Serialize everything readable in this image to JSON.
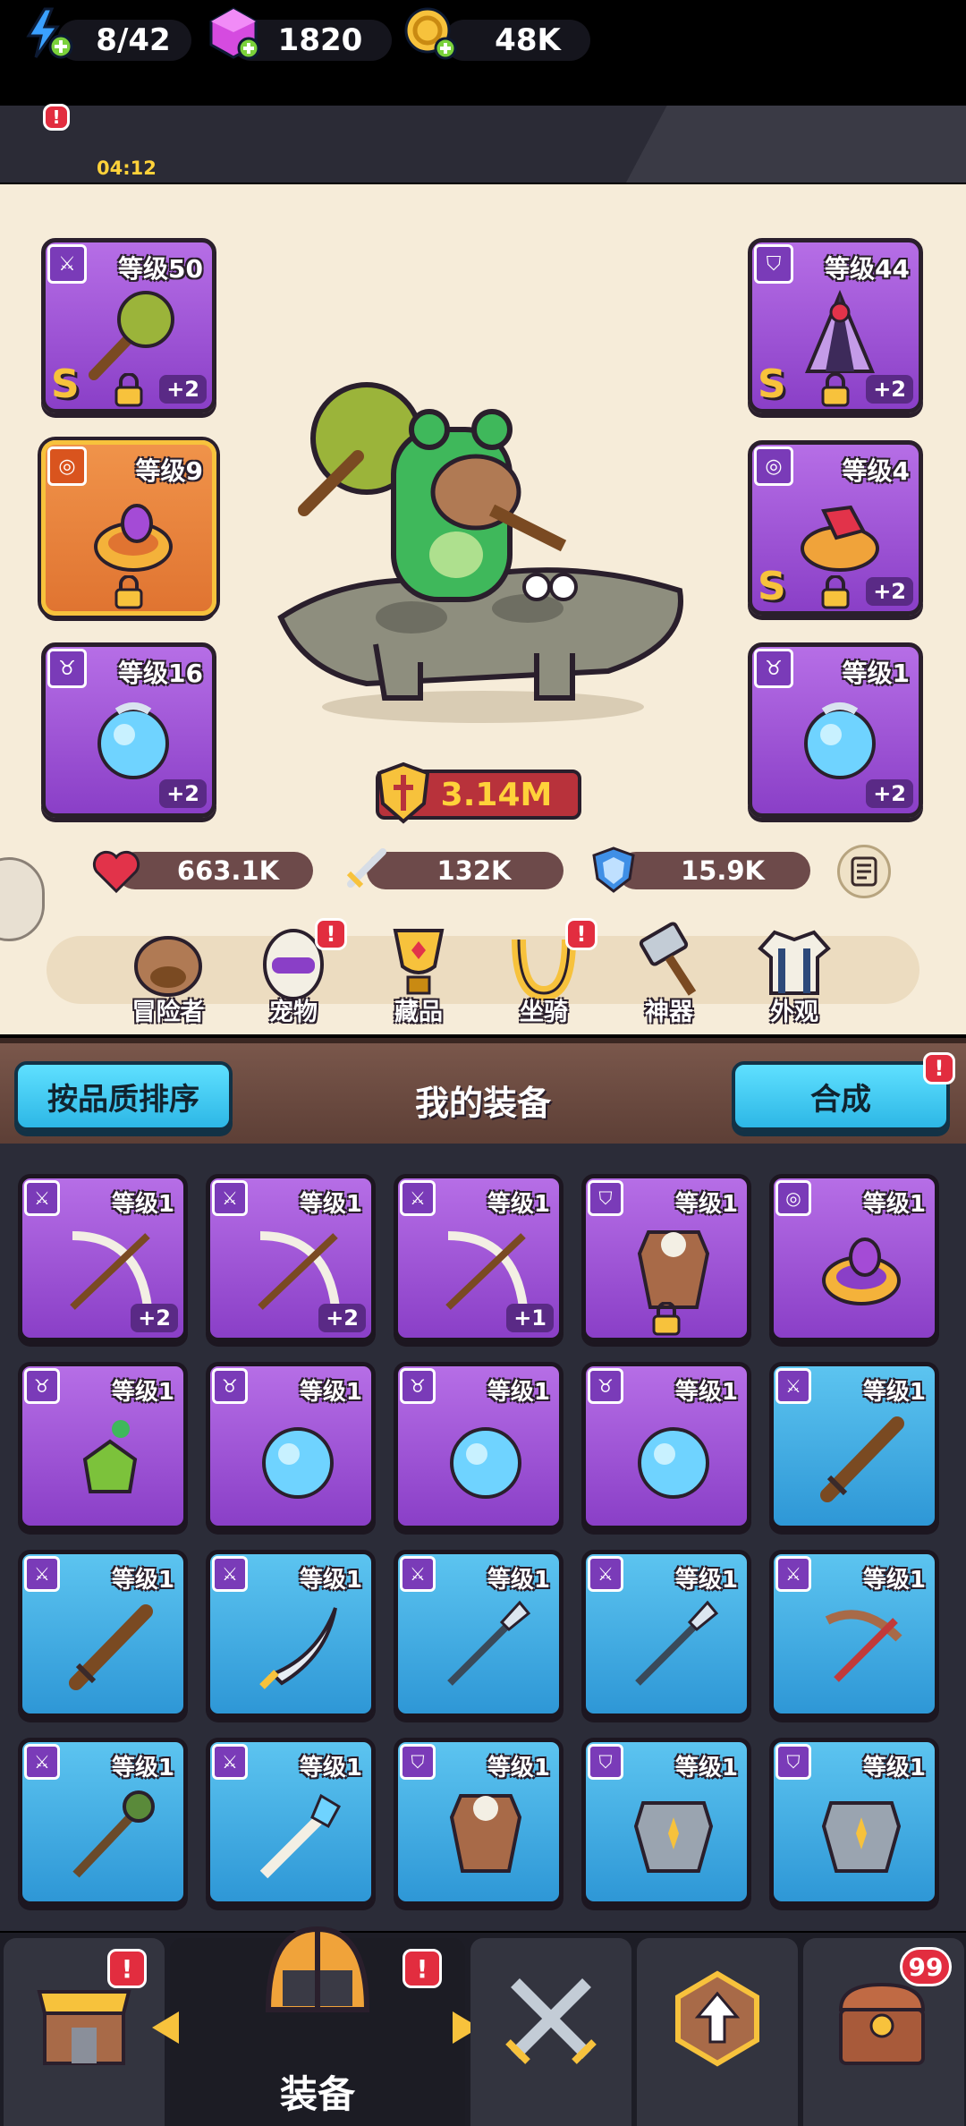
{
  "resources": {
    "energy": "8/42",
    "energy_timer": "04:12",
    "gems": "1820",
    "coins": "48K"
  },
  "hero": {
    "power": "3.14M",
    "stats": {
      "hp": "663.1K",
      "attack": "132K",
      "defense": "15.9K"
    },
    "slots": [
      {
        "level": "等级50",
        "plus": "+2",
        "s": "S"
      },
      {
        "level": "等级9"
      },
      {
        "level": "等级16",
        "plus": "+2"
      },
      {
        "level": "等级44",
        "plus": "+2",
        "s": "S"
      },
      {
        "level": "等级4",
        "plus": "+2",
        "s": "S"
      },
      {
        "level": "等级1",
        "plus": "+2"
      }
    ]
  },
  "menu": [
    "冒险者",
    "宠物",
    "藏品",
    "坐骑",
    "神器",
    "外观"
  ],
  "equipment": {
    "sort_button": "按品质排序",
    "title": "我的装备",
    "merge_button": "合成",
    "level_label": "等级1",
    "plus_labels": [
      "+2",
      "+2",
      "+1"
    ]
  },
  "nav": {
    "label": "装备",
    "chest_count": "99"
  },
  "colors": {
    "purple_rarity": "#9b4fd6",
    "blue_rarity": "#3aa8e3",
    "orange_rarity": "#e8813c",
    "accent_cyan": "#3fc8ef",
    "alert_red": "#e22d3f"
  }
}
